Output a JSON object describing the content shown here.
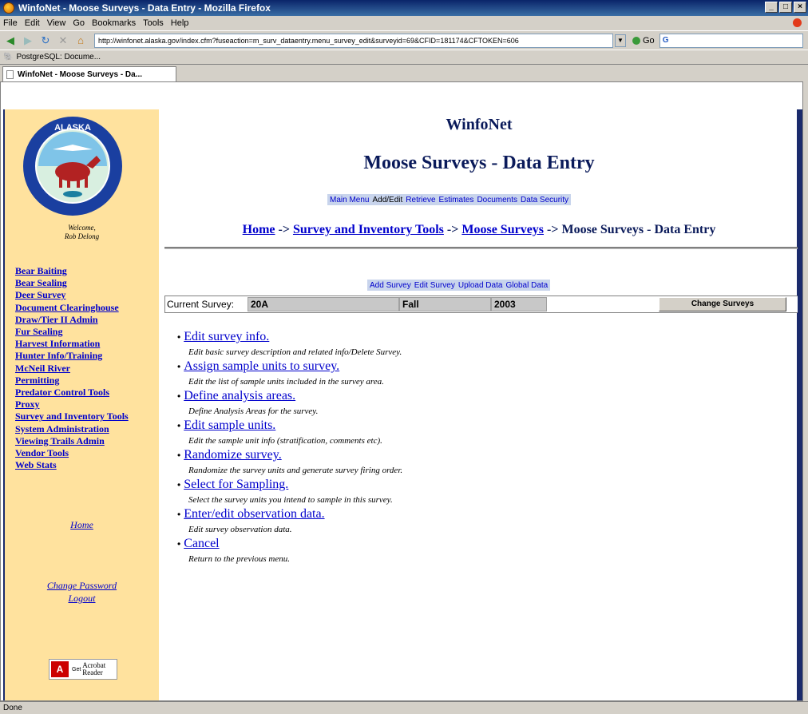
{
  "window": {
    "title": "WinfoNet - Moose Surveys - Data Entry - Mozilla Firefox",
    "buttons": [
      "_",
      "□",
      "×"
    ]
  },
  "menu": [
    "File",
    "Edit",
    "View",
    "Go",
    "Bookmarks",
    "Tools",
    "Help"
  ],
  "toolbar": {
    "url": "http://winfonet.alaska.gov/index.cfm?fuseaction=m_surv_dataentry.menu_survey_edit&surveyid=69&CFID=181174&CFTOKEN=606",
    "go_label": "Go",
    "search_value": "G"
  },
  "bookmarks": [
    "PostgreSQL: Docume..."
  ],
  "tab": {
    "label": "WinfoNet - Moose Surveys - Da..."
  },
  "sidebar": {
    "welcome": "Welcome,",
    "user": "Rob Delong",
    "links": [
      "Bear Baiting",
      "Bear Sealing",
      "Deer Survey",
      "Document Clearinghouse",
      "Draw/Tier II Admin",
      "Fur Sealing",
      "Harvest Information",
      "Hunter Info/Training",
      "McNeil River",
      "Permitting",
      "Predator Control Tools",
      "Proxy",
      "Survey and Inventory Tools",
      "System Administration",
      "Viewing Trails Admin",
      "Vendor Tools",
      "Web Stats"
    ],
    "home": "Home",
    "change_password": "Change Password",
    "logout": "Logout",
    "acrobat_get": "Get",
    "acrobat_line1": "Acrobat",
    "acrobat_line2": "Reader",
    "logo_text": "ALASKA DEPARTMENT OF FISH AND GAME"
  },
  "main": {
    "site_title": "WinfoNet",
    "page_title": "Moose Surveys - Data Entry",
    "topnav": [
      "Main Menu",
      "Add/Edit",
      "Retrieve",
      "Estimates",
      "Documents",
      "Data Security"
    ],
    "breadcrumb": {
      "home": "Home",
      "sep": "->",
      "survey_tools": "Survey and Inventory Tools",
      "moose": "Moose Surveys",
      "current": "Moose Surveys - Data Entry"
    },
    "subnav": [
      "Add Survey",
      "Edit Survey",
      "Upload Data",
      "Global Data"
    ],
    "current_survey_label": "Current Survey:",
    "current_survey": {
      "unit": "20A",
      "season": "Fall",
      "year": "2003"
    },
    "change_surveys": "Change Surveys",
    "actions": [
      {
        "link": "Edit survey info.",
        "desc": "Edit basic survey description and related info/Delete Survey."
      },
      {
        "link": "Assign sample units to survey.",
        "desc": "Edit the list of sample units included in the survey area."
      },
      {
        "link": "Define analysis areas.",
        "desc": "Define Analysis Areas for the survey."
      },
      {
        "link": "Edit sample units.",
        "desc": "Edit the sample unit info (stratification, comments etc)."
      },
      {
        "link": "Randomize survey.",
        "desc": "Randomize the survey units and generate survey firing order."
      },
      {
        "link": "Select for Sampling.",
        "desc": "Select the survey units you intend to sample in this survey."
      },
      {
        "link": "Enter/edit observation data.",
        "desc": "Edit survey observation data."
      },
      {
        "link": "Cancel",
        "desc": "Return to the previous menu."
      }
    ]
  },
  "status": "Done",
  "colors": {
    "sidebar_bg": "#ffe29e",
    "frame": "#1a2a6c",
    "link": "#0000cc",
    "title": "#0a1a5a",
    "nav_bg": "#c8d4ec"
  }
}
